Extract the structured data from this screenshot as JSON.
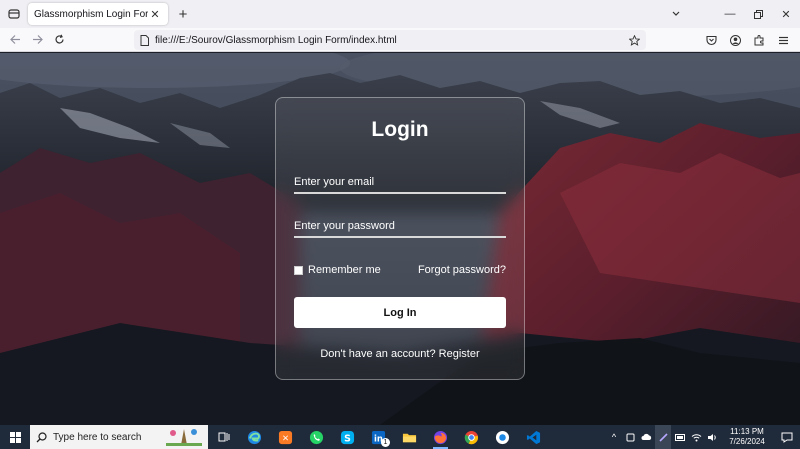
{
  "browser": {
    "tab_title": "Glassmorphism Login Form",
    "url": "file:///E:/Sourov/Glassmorphism Login Form/index.html"
  },
  "login": {
    "title": "Login",
    "email_placeholder": "Enter your email",
    "password_placeholder": "Enter your password",
    "remember_label": "Remember me",
    "forgot_label": "Forgot password?",
    "button_label": "Log In",
    "register_prompt": "Don't have an account?",
    "register_link": "Register"
  },
  "taskbar": {
    "search_placeholder": "Type here to search",
    "time": "11:13 PM",
    "date": "7/26/2024",
    "linkedin_badge": "1"
  },
  "colors": {
    "accent_vscode": "#0078d4",
    "taskbar_bg": "#1f2a3a"
  }
}
